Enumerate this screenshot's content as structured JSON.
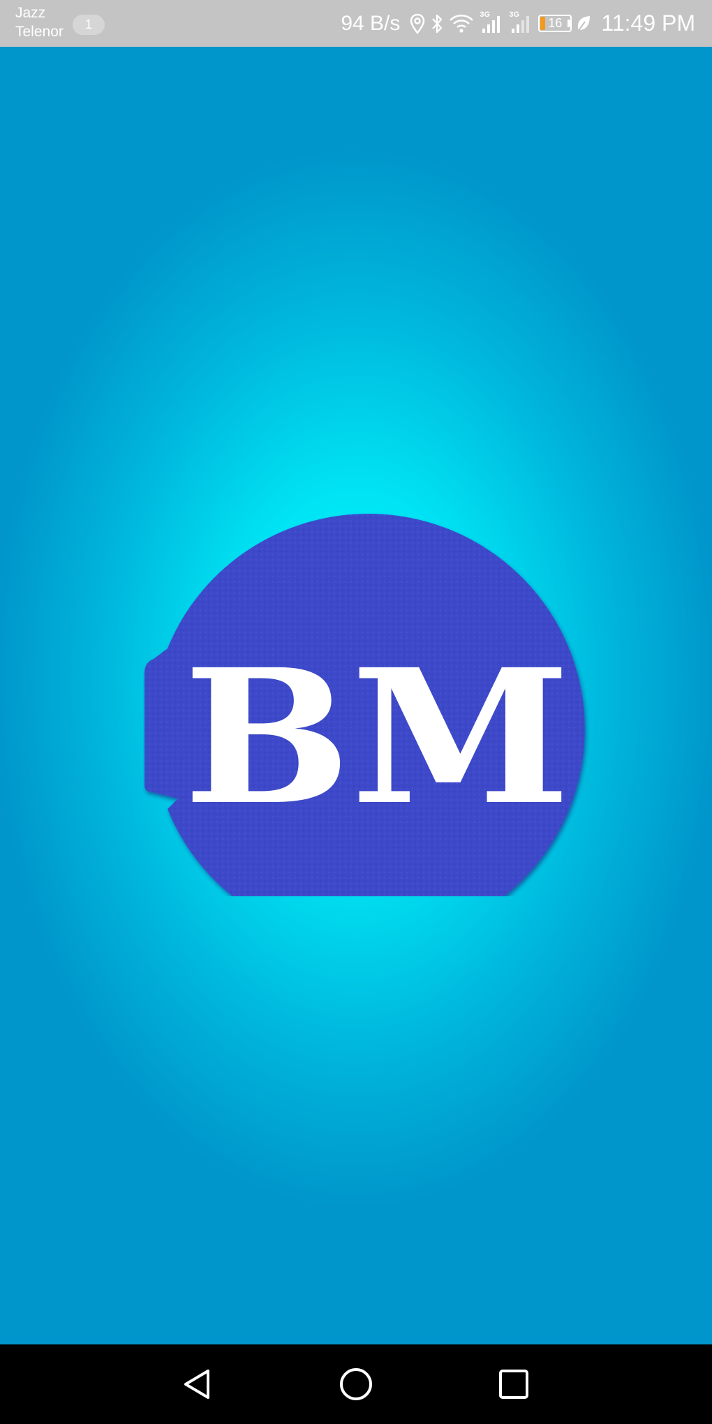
{
  "status_bar": {
    "carrier_1": "Jazz",
    "carrier_2": "Telenor",
    "notification_count": "1",
    "net_speed": "94 B/s",
    "signal_1_tag": "3G",
    "signal_2_tag": "3G",
    "battery_level": "16",
    "battery_fraction": 0.16,
    "time": "11:49 PM",
    "icons": [
      "location-icon",
      "bluetooth-icon",
      "wifi-icon",
      "signal-icon",
      "signal-icon",
      "battery-icon",
      "leaf-icon"
    ]
  },
  "splash": {
    "logo_text": "BM",
    "colors": {
      "logo_circle": "#3d4ac9",
      "logo_text": "#ffffff",
      "background_center": "#00f6fb",
      "background_edge": "#0096cb"
    }
  },
  "nav_bar": {
    "buttons": [
      "back-icon",
      "home-icon",
      "recents-icon"
    ]
  }
}
